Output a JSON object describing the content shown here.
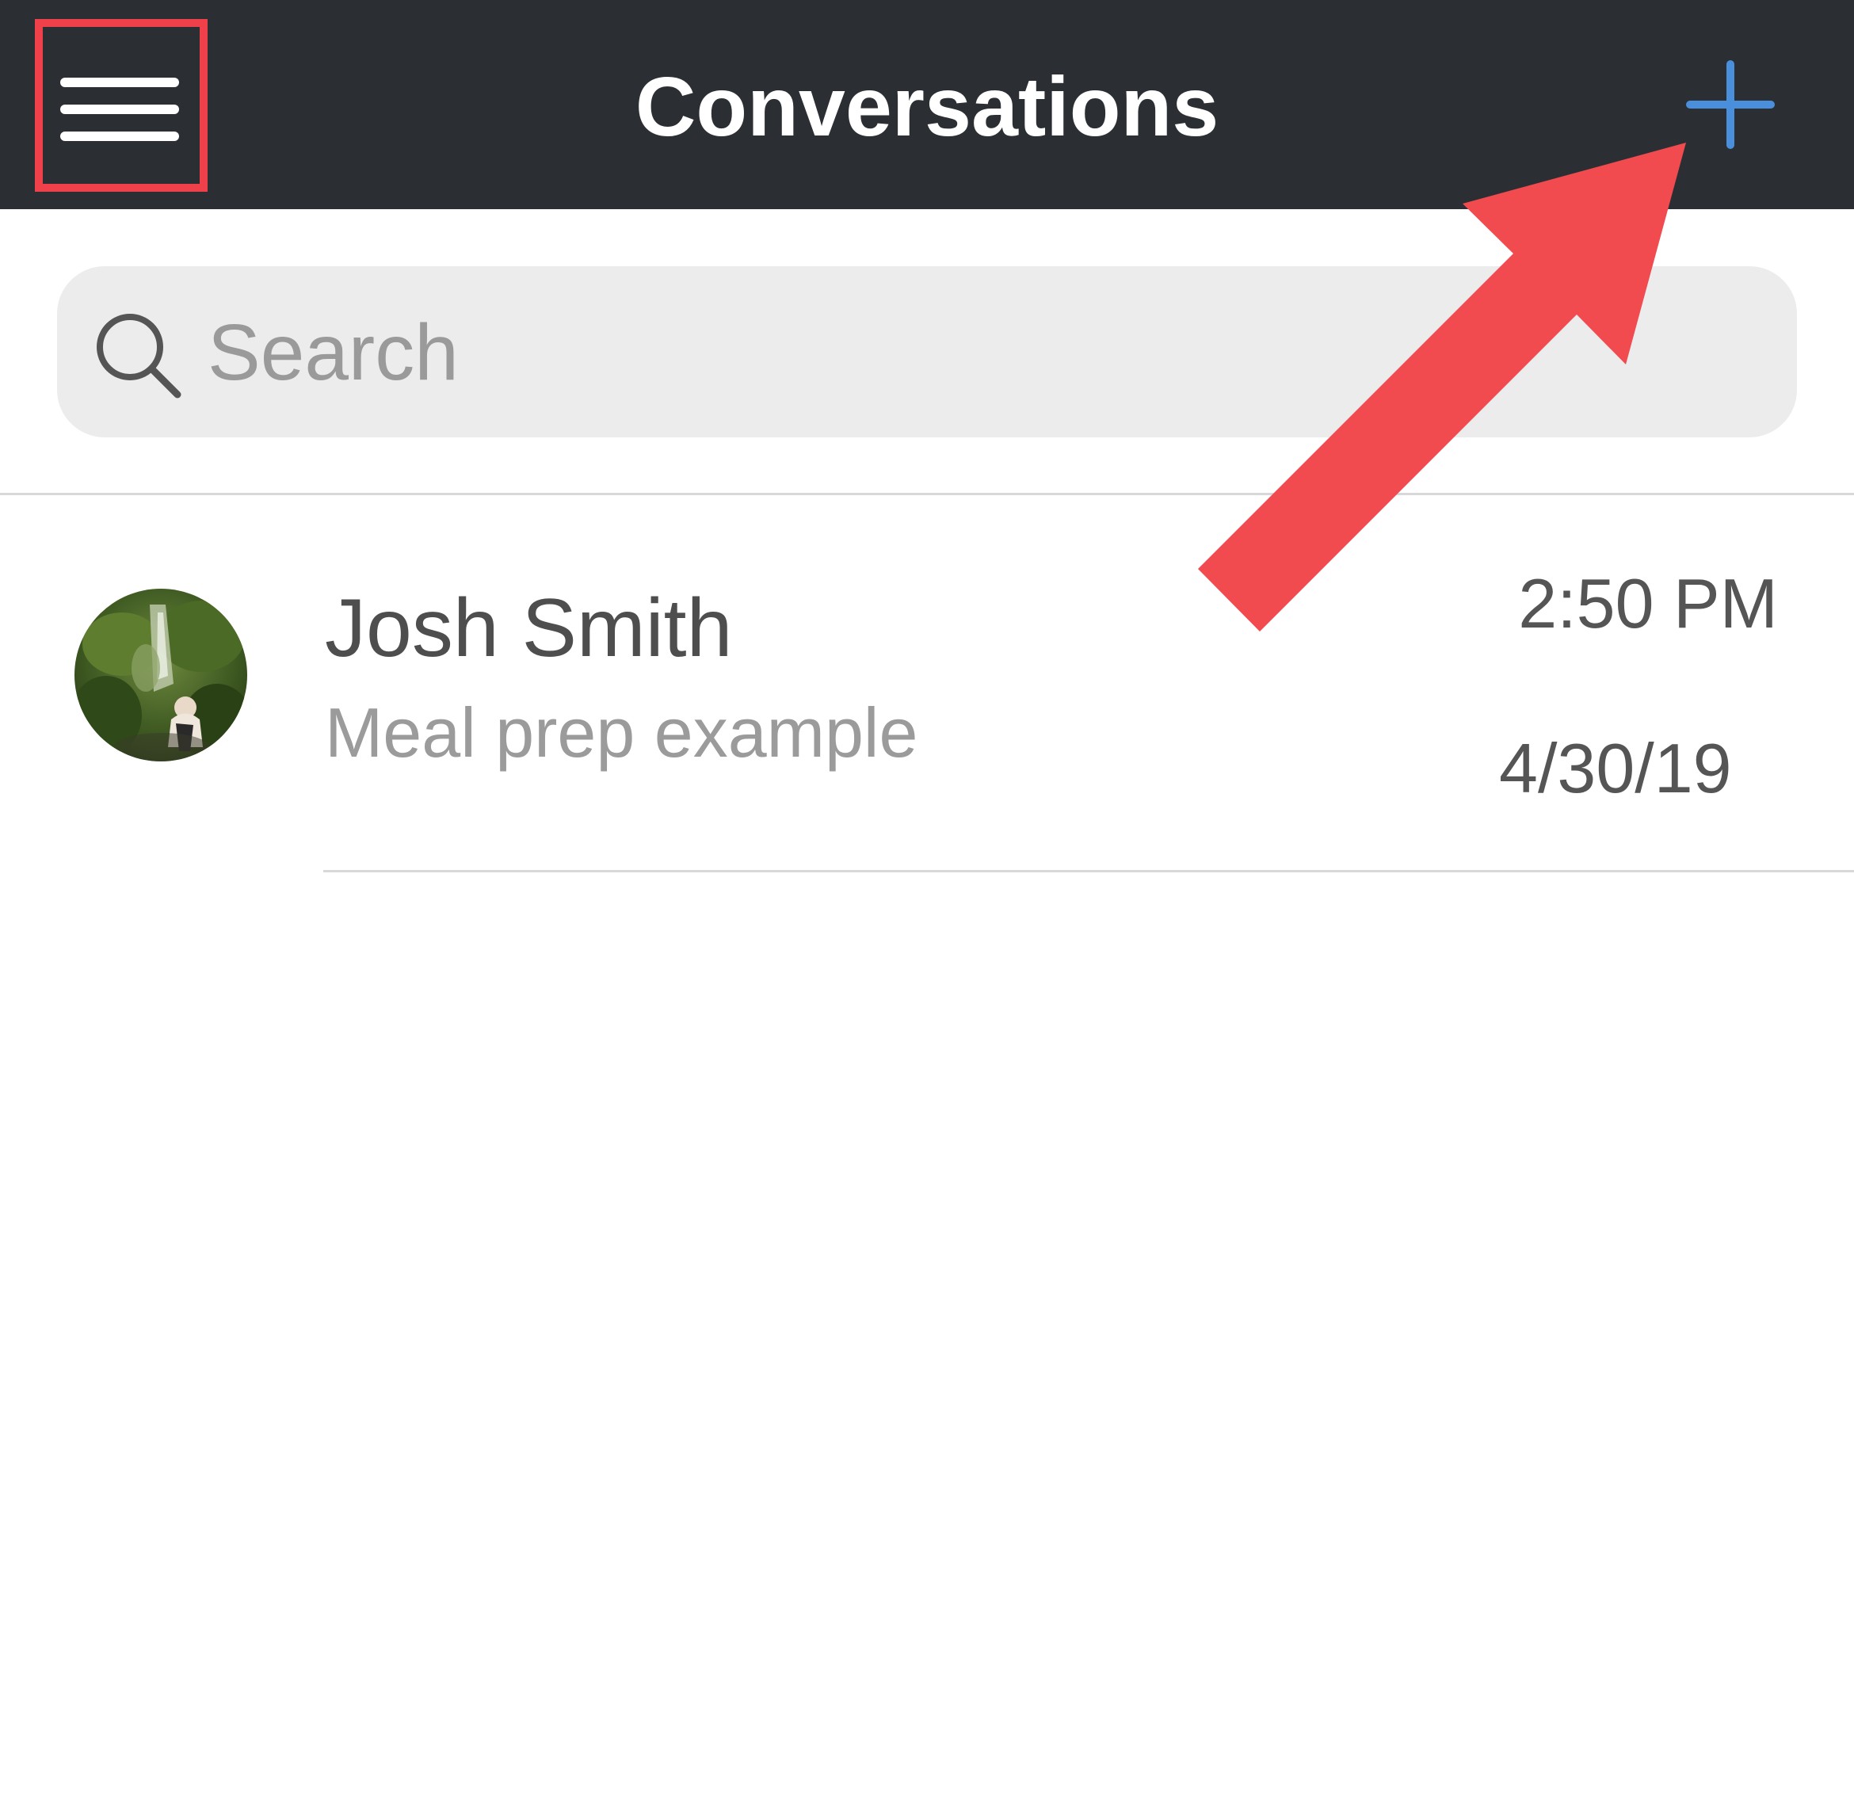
{
  "header": {
    "title": "Conversations",
    "menu_icon": "hamburger-menu-icon",
    "add_icon": "plus-icon",
    "background_color": "#2b2f33",
    "accent_color": "#4a8fdc"
  },
  "search": {
    "placeholder": "Search",
    "value": "",
    "icon": "search-icon"
  },
  "conversations": [
    {
      "name": "Josh Smith",
      "preview": "Meal prep example",
      "time": "2:50 PM",
      "date": "4/30/19",
      "avatar": "profile-photo"
    }
  ],
  "annotations": {
    "highlight_color": "#f0404a",
    "highlight_target": "menu-button",
    "arrow_target": "add-conversation-button"
  }
}
